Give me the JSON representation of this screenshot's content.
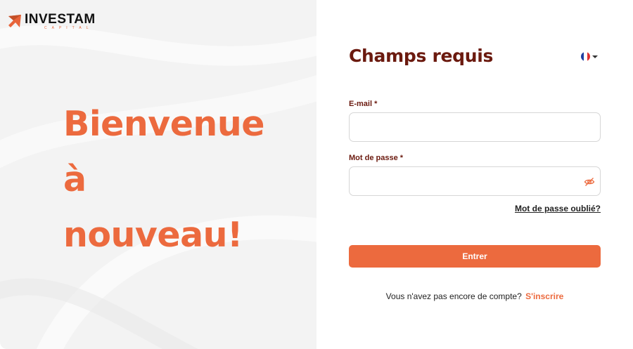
{
  "logo": {
    "brand": "INVESTAM",
    "sub": "CAPITAL",
    "icon": "investam-logo-icon"
  },
  "hero": {
    "lines": [
      "Bienvenue",
      "à",
      "nouveau!"
    ]
  },
  "form": {
    "title": "Champs requis",
    "language": {
      "icon": "france-flag-icon",
      "caret": "chevron-down-icon"
    },
    "email": {
      "label": "E-mail *",
      "value": "",
      "placeholder": ""
    },
    "password": {
      "label": "Mot de passe *",
      "value": "",
      "placeholder": "",
      "toggle_icon": "eye-slash-icon"
    },
    "forgot_label": "Mot de passe oublié?",
    "submit_label": "Entrer",
    "signup_prompt": "Vous n'avez pas encore de compte?",
    "signup_link": "S'inscrire"
  },
  "colors": {
    "accent": "#ec6a3e",
    "title": "#6b1a0f",
    "left_bg": "#f3f3f3"
  }
}
